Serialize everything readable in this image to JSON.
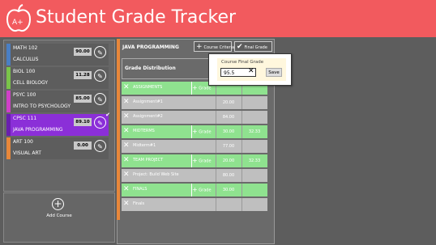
{
  "header": {
    "app_title": "Student Grade Tracker",
    "logo_text": "A+",
    "color": "#f25a5e"
  },
  "courses": [
    {
      "name": "MATH 102",
      "description": "CALCULUS",
      "grade": "90.00",
      "color": "#4a7fc4"
    },
    {
      "name": "BIOL 100",
      "description": "CELL BIOLOGY",
      "grade": "11.28",
      "color": "#7ac44a"
    },
    {
      "name": "PSYC 100",
      "description": "INTRO TO PSYCHOLOGY",
      "grade": "85.00",
      "color": "#d040c8"
    },
    {
      "name": "CPSC 111",
      "description": "JAVA PROGRAMMING",
      "grade": "89.10",
      "color": "#8b2fd8",
      "selected": true
    },
    {
      "name": "ART 100",
      "description": "VISUAL ART",
      "grade": "0.00",
      "color": "#e8873a"
    }
  ],
  "add_course_label": "Add Course",
  "main": {
    "course_title": "JAVA PROGRAMMING",
    "course_criteria_label": "Course Criteria",
    "final_grade_label": "Final Grade",
    "grade_distribution_label": "Grade Distribution"
  },
  "grade_rows": [
    {
      "label": "ASSIGNMENTS",
      "type": "category",
      "grade_label": "Grade",
      "v1": "",
      "v2": ""
    },
    {
      "label": "Assignment#1",
      "type": "item",
      "v1": "20.00",
      "v2": ""
    },
    {
      "label": "Assignment#2",
      "type": "item",
      "v1": "84.00",
      "v2": ""
    },
    {
      "label": "MIDTERMS",
      "type": "category",
      "grade_label": "Grade",
      "v1": "30.00",
      "v2": "32.33"
    },
    {
      "label": "Midterm#1",
      "type": "item",
      "v1": "77.00",
      "v2": ""
    },
    {
      "label": "TEAM PROJECT",
      "type": "category",
      "grade_label": "Grade",
      "v1": "20.00",
      "v2": "32.33"
    },
    {
      "label": "Project: Build Web Site",
      "type": "item",
      "v1": "80.00",
      "v2": ""
    },
    {
      "label": "FINALS",
      "type": "category",
      "grade_label": "Grade",
      "v1": "30.00",
      "v2": ""
    },
    {
      "label": "Finals",
      "type": "item",
      "v1": "",
      "v2": ""
    }
  ],
  "popup": {
    "label": "Course Final Grade",
    "input_value": "95.5",
    "save_label": "Save"
  }
}
